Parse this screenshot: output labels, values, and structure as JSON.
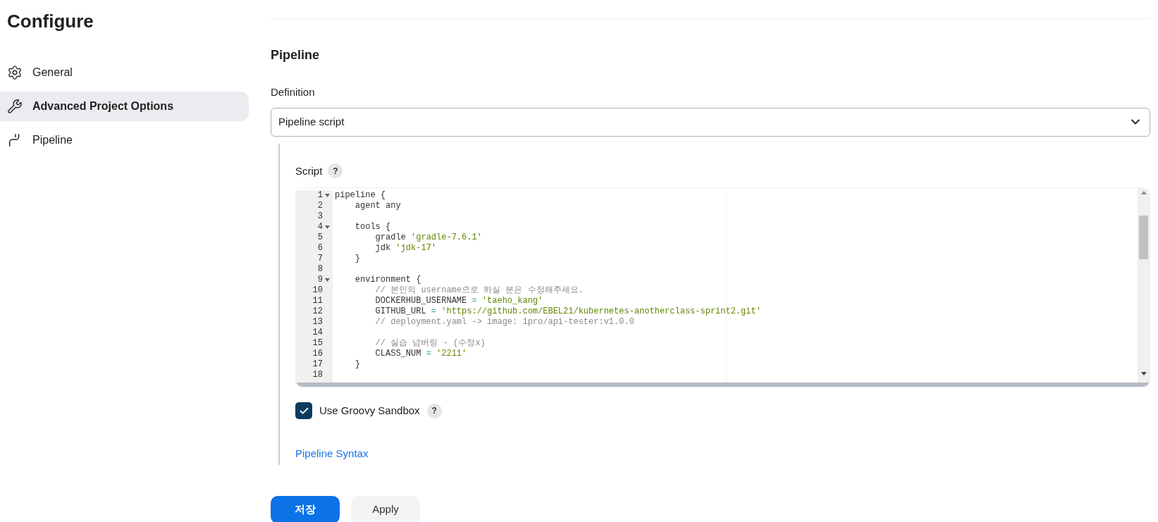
{
  "page_title": "Configure",
  "sidebar": {
    "items": [
      {
        "label": "General",
        "kind": "gear",
        "selected": false
      },
      {
        "label": "Advanced Project Options",
        "kind": "wrench",
        "selected": true
      },
      {
        "label": "Pipeline",
        "kind": "pipeline",
        "selected": false
      }
    ]
  },
  "section": {
    "title": "Pipeline",
    "definition": {
      "label": "Definition",
      "value": "Pipeline script"
    },
    "script": {
      "label": "Script",
      "help": "?",
      "lines": [
        {
          "number": "1",
          "foldable": true,
          "segments": [
            {
              "kind": "plain",
              "text": "pipeline {"
            }
          ]
        },
        {
          "number": "2",
          "foldable": false,
          "segments": [
            {
              "kind": "plain",
              "text": "    agent any"
            }
          ]
        },
        {
          "number": "3",
          "foldable": false
        },
        {
          "number": "4",
          "foldable": true,
          "segments": [
            {
              "kind": "plain",
              "text": "    tools {"
            }
          ]
        },
        {
          "number": "5",
          "foldable": false,
          "segments": [
            {
              "kind": "plain",
              "text": "        gradle "
            },
            {
              "kind": "string",
              "text": "'gradle-7.6.1'"
            }
          ]
        },
        {
          "number": "6",
          "foldable": false,
          "segments": [
            {
              "kind": "plain",
              "text": "        jdk "
            },
            {
              "kind": "string",
              "text": "'jdk-17'"
            }
          ]
        },
        {
          "number": "7",
          "foldable": false,
          "segments": [
            {
              "kind": "plain",
              "text": "    }"
            }
          ]
        },
        {
          "number": "8",
          "foldable": false
        },
        {
          "number": "9",
          "foldable": true,
          "segments": [
            {
              "kind": "plain",
              "text": "    environment {"
            }
          ]
        },
        {
          "number": "10",
          "foldable": false,
          "segments": [
            {
              "kind": "comment",
              "text": "        // 본인의 username으로 하실 분은 수정해주세요."
            }
          ]
        },
        {
          "number": "11",
          "foldable": false,
          "segments": [
            {
              "kind": "plain",
              "text": "        DOCKERHUB_USERNAME "
            },
            {
              "kind": "operator",
              "text": "= "
            },
            {
              "kind": "string",
              "text": "'taeho_kang'"
            }
          ]
        },
        {
          "number": "12",
          "foldable": false,
          "segments": [
            {
              "kind": "plain",
              "text": "        GITHUB_URL "
            },
            {
              "kind": "operator",
              "text": "= "
            },
            {
              "kind": "string",
              "text": "'https://github.com/EBEL21/kubernetes-anotherclass-sprint2.git'"
            }
          ]
        },
        {
          "number": "13",
          "foldable": false,
          "segments": [
            {
              "kind": "comment",
              "text": "        // deployment.yaml -> image: 1pro/api-tester:v1.0.0"
            }
          ]
        },
        {
          "number": "14",
          "foldable": false
        },
        {
          "number": "15",
          "foldable": false,
          "segments": [
            {
              "kind": "comment",
              "text": "        // 실습 넘버링 - (수정x)"
            }
          ]
        },
        {
          "number": "16",
          "foldable": false,
          "segments": [
            {
              "kind": "plain",
              "text": "        CLASS_NUM "
            },
            {
              "kind": "operator",
              "text": "= "
            },
            {
              "kind": "string",
              "text": "'2211'"
            }
          ]
        },
        {
          "number": "17",
          "foldable": false,
          "segments": [
            {
              "kind": "plain",
              "text": "    }"
            }
          ]
        },
        {
          "number": "18",
          "foldable": false
        }
      ]
    },
    "sandbox": {
      "label": "Use Groovy Sandbox",
      "checked": true,
      "help": "?"
    },
    "syntax_link": "Pipeline Syntax"
  },
  "buttons": [
    {
      "label": "저장",
      "kind": "primary"
    },
    {
      "label": "Apply",
      "kind": "secondary"
    }
  ]
}
